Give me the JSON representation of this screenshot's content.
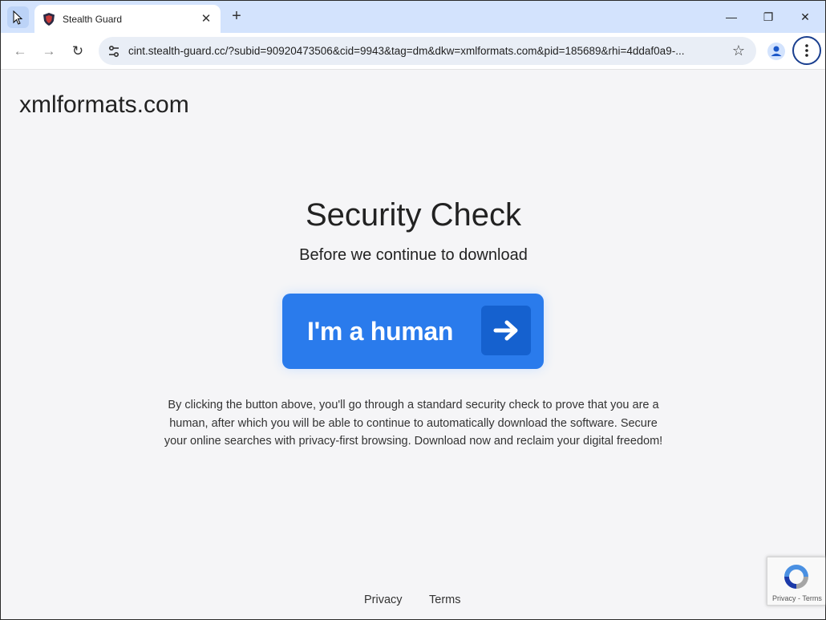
{
  "browser": {
    "tab_title": "Stealth Guard",
    "tab_close": "✕",
    "new_tab": "+",
    "url": "cint.stealth-guard.cc/?subid=90920473506&cid=9943&tag=dm&dkw=xmlformats.com&pid=185689&rhi=4ddaf0a9-...",
    "minimize": "—",
    "restore": "❐",
    "close": "✕",
    "back": "←",
    "forward": "→",
    "reload": "↻",
    "bookmark": "☆"
  },
  "page": {
    "site_domain": "xmlformats.com",
    "heading": "Security Check",
    "subheading": "Before we continue to download",
    "button_label": "I'm a human",
    "description": "By clicking the button above, you'll go through a standard security check to prove that you are a human, after which you will be able to continue to automatically download the software. Secure your online searches with privacy-first browsing. Download now and reclaim your digital freedom!",
    "footer": {
      "privacy": "Privacy",
      "terms": "Terms"
    },
    "recaptcha": {
      "text": "Privacy - Terms"
    }
  },
  "colors": {
    "tabstrip": "#d3e3fd",
    "button": "#2a7bec",
    "button_arrow_box": "#1561cf",
    "page_bg": "#f5f5f7"
  }
}
